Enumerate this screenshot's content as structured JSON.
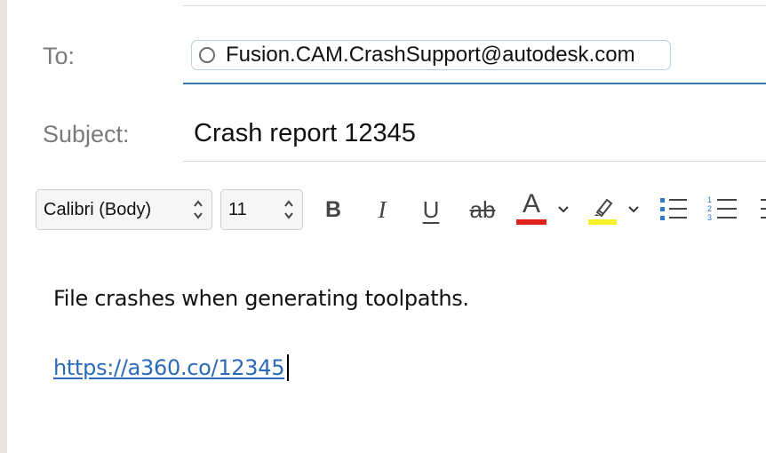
{
  "compose": {
    "to_label": "To:",
    "recipient": "Fusion.CAM.CrashSupport@autodesk.com",
    "subject_label": "Subject:",
    "subject_value": "Crash report 12345"
  },
  "toolbar": {
    "font_family": "Calibri (Body)",
    "font_size": "11",
    "bold_label": "B",
    "italic_label": "I",
    "underline_label": "U",
    "strikethrough_label": "ab",
    "font_color_label": "A",
    "font_color": "#e0221b",
    "highlight_color": "#f5f22a",
    "icons": [
      "bold-icon",
      "italic-icon",
      "underline-icon",
      "strikethrough-icon",
      "font-color-icon",
      "highlight-icon",
      "bullets-icon",
      "numbering-icon"
    ]
  },
  "body": {
    "line1": "File crashes when generating toolpaths.",
    "link": "https://a360.co/12345"
  },
  "colors": {
    "accent": "#3a78b6",
    "link": "#2b6ab9"
  }
}
